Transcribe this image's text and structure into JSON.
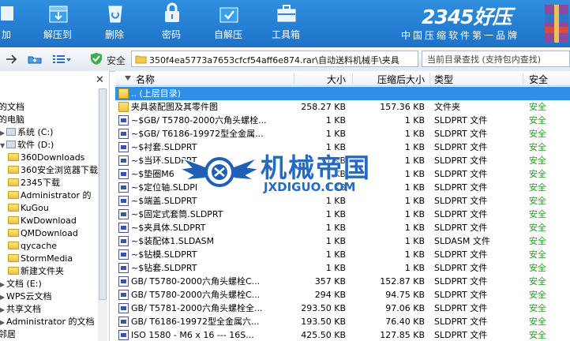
{
  "toolbar": {
    "buttons": [
      {
        "label": "加"
      },
      {
        "label": "解压到"
      },
      {
        "label": "删除"
      },
      {
        "label": "密码"
      },
      {
        "label": "自解压"
      },
      {
        "label": "工具箱"
      }
    ],
    "brand_title": "2345好压",
    "brand_slogan": "中国压缩软件第一品牌"
  },
  "addressbar": {
    "safe_label": "安全",
    "path": "350f4ea5773a7653cfcf54aff6e874.rar\\自动送料机械手\\夹具",
    "search_placeholder": "当前目录查找 (支持包内查找)"
  },
  "tree": {
    "items": [
      {
        "label": "的文档"
      },
      {
        "label": "的电脑"
      },
      {
        "label": "系统 (C:)"
      },
      {
        "label": "软件 (D:)"
      },
      {
        "label": "360Downloads"
      },
      {
        "label": "360安全浏览器下载"
      },
      {
        "label": "2345下载"
      },
      {
        "label": "Administrator 的"
      },
      {
        "label": "KuGou"
      },
      {
        "label": "KwDownload"
      },
      {
        "label": "QMDownload"
      },
      {
        "label": "qycache"
      },
      {
        "label": "StormMedia"
      },
      {
        "label": "新建文件夹"
      },
      {
        "label": "文档 (E:)"
      },
      {
        "label": "WPS云文档"
      },
      {
        "label": "共享文档"
      },
      {
        "label": "Administrator 的文档"
      },
      {
        "label": "邻居"
      }
    ]
  },
  "list": {
    "columns": {
      "name": "名称",
      "size": "大小",
      "packed": "压缩后大小",
      "type": "类型",
      "safety": "安全"
    },
    "rows": [
      {
        "name": ".. (上层目录)",
        "size": "",
        "packed": "",
        "type": "",
        "safety": "",
        "icon": "folder-icon"
      },
      {
        "name": "夹具装配图及其零件图",
        "size": "258.27 KB",
        "packed": "157.36 KB",
        "type": "文件夹",
        "safety": "安全",
        "icon": "folder-icon"
      },
      {
        "name": "~$GB/ T5780-2000六角头螺栓...",
        "size": "1 KB",
        "packed": "1 KB",
        "type": "SLDPRT 文件",
        "safety": "安全",
        "icon": "sldprt-file-icon"
      },
      {
        "name": "~$GB/ T6186-19972型全金属...",
        "size": "1 KB",
        "packed": "1 KB",
        "type": "SLDPRT 文件",
        "safety": "安全",
        "icon": "sldprt-file-icon"
      },
      {
        "name": "~$衬套.SLDPRT",
        "size": "1 KB",
        "packed": "1 KB",
        "type": "SLDPRT 文件",
        "safety": "安全",
        "icon": "sldprt-file-icon"
      },
      {
        "name": "~$当环.SLDPRT",
        "size": "1 KB",
        "packed": "1 KB",
        "type": "SLDPRT 文件",
        "safety": "安全",
        "icon": "sldprt-file-icon"
      },
      {
        "name": "~$垫圈M6",
        "size": "1 KB",
        "packed": "1 KB",
        "type": "SLDPRT 文件",
        "safety": "安全",
        "icon": "sldprt-file-icon"
      },
      {
        "name": "~$定位轴.SLDPI",
        "size": "1 KB",
        "packed": "1 KB",
        "type": "SLDPRT 文件",
        "safety": "安全",
        "icon": "sldprt-file-icon"
      },
      {
        "name": "~$端盖.SLDPRT",
        "size": "1 KB",
        "packed": "1 KB",
        "type": "SLDPRT 文件",
        "safety": "安全",
        "icon": "sldprt-file-icon"
      },
      {
        "name": "~$固定式套筒.SLDPRT",
        "size": "1 KB",
        "packed": "1 KB",
        "type": "SLDPRT 文件",
        "safety": "安全",
        "icon": "sldprt-file-icon"
      },
      {
        "name": "~$夹具体.SLDPRT",
        "size": "1 KB",
        "packed": "1 KB",
        "type": "SLDPRT 文件",
        "safety": "安全",
        "icon": "sldprt-file-icon"
      },
      {
        "name": "~$装配体1.SLDASM",
        "size": "1 KB",
        "packed": "1 KB",
        "type": "SLDASM 文件",
        "safety": "安全",
        "icon": "sldasm-file-icon"
      },
      {
        "name": "~$钻模.SLDPRT",
        "size": "1 KB",
        "packed": "1 KB",
        "type": "SLDPRT 文件",
        "safety": "安全",
        "icon": "sldprt-file-icon"
      },
      {
        "name": "~$钻套.SLDPRT",
        "size": "1 KB",
        "packed": "1 KB",
        "type": "SLDPRT 文件",
        "safety": "安全",
        "icon": "sldprt-file-icon"
      },
      {
        "name": "GB/ T5780-2000六角头螺栓C...",
        "size": "357 KB",
        "packed": "152.87 KB",
        "type": "SLDPRT 文件",
        "safety": "安全",
        "icon": "sldprt-file-icon"
      },
      {
        "name": "GB/ T5780-2000六角头螺栓C...",
        "size": "294 KB",
        "packed": "94.75 KB",
        "type": "SLDPRT 文件",
        "safety": "安全",
        "icon": "sldprt-file-icon"
      },
      {
        "name": "GB/ T5781-2000六角头螺栓全...",
        "size": "293.50 KB",
        "packed": "97.06 KB",
        "type": "SLDPRT 文件",
        "safety": "安全",
        "icon": "sldprt-file-icon"
      },
      {
        "name": "GB/ T6186-19972型全金属六...",
        "size": "193.50 KB",
        "packed": "76.40 KB",
        "type": "SLDPRT 文件",
        "safety": "安全",
        "icon": "sldprt-file-icon"
      },
      {
        "name": "ISO 1580 - M6 x 16 --- 16S...",
        "size": "425.50 KB",
        "packed": "127.85 KB",
        "type": "SLDPRT 文件",
        "safety": "安全",
        "icon": "sldprt-file-icon"
      }
    ]
  },
  "watermark": {
    "cn": "机械帝国",
    "en": "JXDIGUO.COM"
  },
  "colors": {
    "toolbar_blue": "#1f7fd6",
    "selection_blue": "#2f8fe6",
    "safe_green": "#25a025",
    "watermark_blue": "#2569c4"
  }
}
